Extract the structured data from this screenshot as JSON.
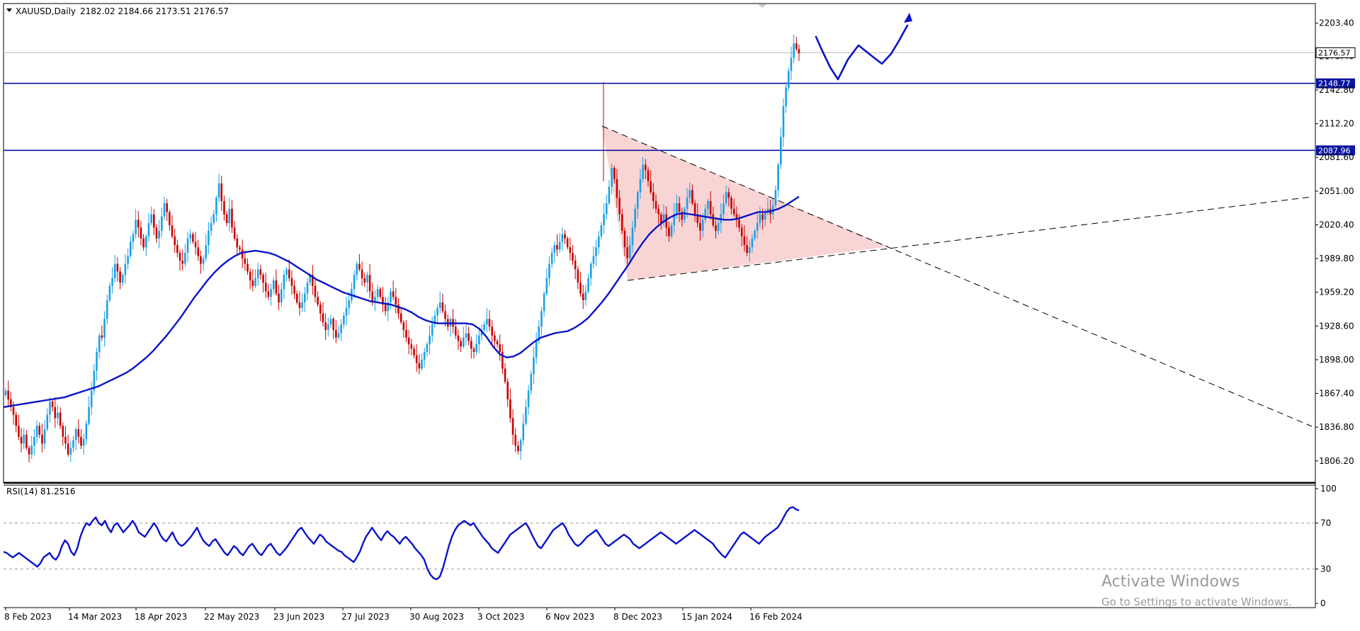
{
  "window": {
    "symbol_header": "XAUUSD,Daily",
    "ohlc": "2182.02 2184.66 2173.51 2176.57"
  },
  "chart_data": [
    {
      "type": "candlestick",
      "title": "XAUUSD,Daily",
      "ohlc_label": "2182.02 2184.66 2173.51 2176.57",
      "ylim": [
        1790,
        2218
      ],
      "y_ticks": [
        "2203.40",
        "2173.40",
        "2142.80",
        "2112.20",
        "2081.60",
        "2051.00",
        "2020.40",
        "1989.80",
        "1959.20",
        "1928.60",
        "1898.00",
        "1867.40",
        "1836.80",
        "1806.20"
      ],
      "x_tick_labels": [
        "8 Feb 2023",
        "14 Mar 2023",
        "18 Apr 2023",
        "22 May 2023",
        "23 Jun 2023",
        "27 Jul 2023",
        "30 Aug 2023",
        "3 Oct 2023",
        "6 Nov 2023",
        "8 Dec 2023",
        "15 Jan 2024",
        "16 Feb 2024"
      ],
      "current_price": "2176.57",
      "horizontal_levels": [
        {
          "value": 2148.77,
          "label": "2148.77",
          "color": "#0a14a0"
        },
        {
          "value": 2087.96,
          "label": "2087.96",
          "color": "#0a14a0"
        }
      ],
      "close_series": [
        1870,
        1862,
        1855,
        1848,
        1838,
        1828,
        1822,
        1830,
        1818,
        1812,
        1820,
        1828,
        1838,
        1830,
        1822,
        1835,
        1848,
        1860,
        1855,
        1845,
        1850,
        1838,
        1828,
        1822,
        1812,
        1818,
        1825,
        1835,
        1828,
        1820,
        1826,
        1840,
        1855,
        1870,
        1888,
        1905,
        1920,
        1918,
        1935,
        1952,
        1965,
        1972,
        1985,
        1978,
        1968,
        1975,
        1985,
        1992,
        2005,
        2012,
        2025,
        2018,
        2008,
        2000,
        2010,
        2022,
        2030,
        2018,
        2008,
        2015,
        2028,
        2040,
        2032,
        2020,
        2010,
        2002,
        1995,
        1988,
        1985,
        1995,
        2008,
        2012,
        2005,
        2000,
        1992,
        1985,
        1990,
        2002,
        2015,
        2022,
        2030,
        2045,
        2058,
        2042,
        2030,
        2022,
        2035,
        2018,
        2008,
        2000,
        1998,
        1990,
        1985,
        1978,
        1970,
        1965,
        1972,
        1980,
        1975,
        1968,
        1960,
        1955,
        1962,
        1970,
        1958,
        1950,
        1962,
        1975,
        1980,
        1972,
        1965,
        1958,
        1950,
        1945,
        1950,
        1958,
        1968,
        1975,
        1965,
        1955,
        1948,
        1940,
        1932,
        1925,
        1930,
        1935,
        1925,
        1918,
        1922,
        1930,
        1938,
        1945,
        1952,
        1962,
        1975,
        1985,
        1980,
        1972,
        1968,
        1975,
        1960,
        1950,
        1955,
        1962,
        1955,
        1948,
        1942,
        1950,
        1960,
        1955,
        1948,
        1940,
        1932,
        1925,
        1918,
        1912,
        1908,
        1902,
        1895,
        1890,
        1898,
        1905,
        1912,
        1920,
        1930,
        1938,
        1945,
        1950,
        1942,
        1935,
        1928,
        1935,
        1928,
        1920,
        1915,
        1910,
        1918,
        1922,
        1915,
        1908,
        1905,
        1912,
        1920,
        1925,
        1930,
        1935,
        1928,
        1920,
        1915,
        1912,
        1905,
        1890,
        1878,
        1862,
        1845,
        1830,
        1820,
        1815,
        1825,
        1840,
        1855,
        1870,
        1885,
        1900,
        1915,
        1928,
        1942,
        1958,
        1972,
        1985,
        1995,
        2002,
        1998,
        2005,
        2012,
        2008,
        2000,
        1995,
        1988,
        1980,
        1968,
        1958,
        1952,
        1960,
        1972,
        1985,
        1992,
        2000,
        2010,
        2020,
        2030,
        2040,
        2055,
        2072,
        2062,
        2045,
        2030,
        2015,
        2000,
        1990,
        2002,
        2018,
        2035,
        2050,
        2062,
        2075,
        2070,
        2060,
        2050,
        2042,
        2035,
        2030,
        2022,
        2030,
        2018,
        2010,
        2020,
        2030,
        2040,
        2032,
        2025,
        2035,
        2045,
        2052,
        2040,
        2030,
        2022,
        2015,
        2025,
        2035,
        2042,
        2030,
        2020,
        2015,
        2022,
        2030,
        2040,
        2050,
        2045,
        2035,
        2030,
        2025,
        2018,
        2010,
        2002,
        1995,
        2000,
        2008,
        2015,
        2022,
        2030,
        2025,
        2032,
        2035,
        2030,
        2038,
        2052,
        2075,
        2100,
        2128,
        2145,
        2160,
        2172,
        2185,
        2180,
        2176
      ],
      "ma_series": [
        1855,
        1856,
        1857,
        1858,
        1859,
        1860,
        1861,
        1862,
        1863,
        1864,
        1866,
        1868,
        1870,
        1872,
        1874,
        1877,
        1880,
        1883,
        1886,
        1890,
        1895,
        1900,
        1906,
        1913,
        1920,
        1928,
        1936,
        1945,
        1954,
        1962,
        1970,
        1977,
        1983,
        1988,
        1992,
        1995,
        1996,
        1997,
        1996,
        1995,
        1993,
        1990,
        1987,
        1983,
        1979,
        1975,
        1971,
        1968,
        1965,
        1962,
        1959,
        1957,
        1955,
        1953,
        1951,
        1950,
        1949,
        1948,
        1946,
        1944,
        1941,
        1937,
        1934,
        1932,
        1931,
        1931,
        1931,
        1931,
        1931,
        1930,
        1926,
        1919,
        1910,
        1903,
        1900,
        1901,
        1904,
        1909,
        1914,
        1918,
        1920,
        1922,
        1923,
        1924,
        1927,
        1931,
        1936,
        1943,
        1950,
        1958,
        1967,
        1976,
        1985,
        1995,
        2004,
        2012,
        2018,
        2023,
        2027,
        2030,
        2031,
        2030,
        2029,
        2028,
        2027,
        2026,
        2025,
        2025,
        2026,
        2028,
        2030,
        2032,
        2032,
        2033,
        2035,
        2038,
        2042,
        2046
      ]
    },
    {
      "type": "line",
      "title": "RSI(14) 81.2516",
      "ylim": [
        0,
        100
      ],
      "y_ticks": [
        "100",
        "70",
        "30",
        "0"
      ],
      "levels": [
        70,
        30
      ],
      "values": [
        45,
        44,
        42,
        40,
        42,
        44,
        42,
        40,
        38,
        36,
        34,
        32,
        35,
        40,
        42,
        44,
        40,
        38,
        42,
        50,
        55,
        52,
        45,
        42,
        48,
        58,
        65,
        70,
        68,
        72,
        75,
        70,
        68,
        72,
        66,
        62,
        68,
        70,
        66,
        62,
        65,
        68,
        72,
        68,
        62,
        60,
        58,
        62,
        66,
        70,
        66,
        60,
        56,
        54,
        58,
        62,
        56,
        52,
        50,
        52,
        55,
        58,
        62,
        66,
        60,
        55,
        52,
        50,
        54,
        56,
        52,
        48,
        44,
        42,
        46,
        50,
        48,
        44,
        42,
        46,
        50,
        52,
        48,
        44,
        42,
        46,
        50,
        52,
        48,
        44,
        42,
        45,
        48,
        52,
        56,
        60,
        64,
        66,
        62,
        58,
        55,
        52,
        56,
        60,
        58,
        54,
        52,
        50,
        48,
        46,
        45,
        42,
        40,
        38,
        36,
        40,
        45,
        52,
        58,
        62,
        66,
        62,
        58,
        55,
        60,
        63,
        60,
        58,
        55,
        52,
        56,
        58,
        55,
        52,
        48,
        45,
        42,
        38,
        30,
        25,
        22,
        21,
        23,
        30,
        40,
        50,
        58,
        64,
        68,
        70,
        72,
        70,
        68,
        70,
        66,
        62,
        58,
        55,
        52,
        48,
        46,
        44,
        48,
        52,
        56,
        60,
        62,
        64,
        66,
        68,
        70,
        66,
        60,
        55,
        50,
        48,
        52,
        56,
        60,
        64,
        66,
        68,
        70,
        66,
        60,
        56,
        52,
        50,
        52,
        55,
        58,
        60,
        62,
        64,
        60,
        56,
        52,
        50,
        52,
        54,
        56,
        58,
        60,
        58,
        56,
        52,
        50,
        48,
        50,
        52,
        54,
        56,
        58,
        60,
        62,
        60,
        58,
        56,
        54,
        52,
        54,
        56,
        58,
        60,
        62,
        64,
        62,
        60,
        58,
        56,
        54,
        52,
        48,
        45,
        42,
        40,
        44,
        48,
        52,
        56,
        60,
        62,
        60,
        58,
        56,
        54,
        52,
        55,
        58,
        60,
        62,
        64,
        66,
        70,
        75,
        80,
        83,
        84,
        82,
        81
      ]
    }
  ],
  "watermark": {
    "line1": "Activate Windows",
    "line2": "Go to Settings to activate Windows."
  },
  "colors": {
    "bull": "#1aa0e6",
    "bear": "#c80000",
    "ma": "#0a14c8",
    "level": "#0a14a0",
    "triangle_fill": "#f9d4d4",
    "grid_dash": "#9a9a9a"
  }
}
